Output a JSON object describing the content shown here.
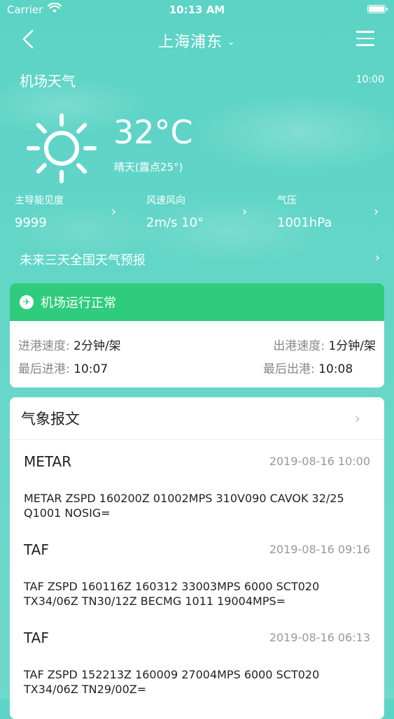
{
  "status_bar": {
    "carrier": "Carrier",
    "time": "10:13 AM"
  },
  "nav": {
    "title": "上海浦东",
    "title_chevron": "⌄"
  },
  "weather": {
    "section_title": "机场天气",
    "update_time": "10:00",
    "temperature": "32°C",
    "condition": "晴天(露点25°)",
    "metrics": [
      {
        "label": "主导能见度",
        "value": "9999"
      },
      {
        "label": "风速风向",
        "value": "2m/s 10°"
      },
      {
        "label": "气压",
        "value": "1001hPa"
      }
    ],
    "forecast_link": "未来三天全国天气预报"
  },
  "operations": {
    "status": "机场运行正常",
    "arrival_speed_label": "进港速度:",
    "arrival_speed_value": "2分钟/架",
    "departure_speed_label": "出港速度:",
    "departure_speed_value": "1分钟/架",
    "last_arrival_label": "最后进港:",
    "last_arrival_value": "10:07",
    "last_departure_label": "最后出港:",
    "last_departure_value": "10:08"
  },
  "reports": {
    "title": "气象报文",
    "items": [
      {
        "type": "METAR",
        "date": "2019-08-16 10:00",
        "text": "METAR ZSPD 160200Z 01002MPS 310V090 CAVOK 32/25 Q1001 NOSIG="
      },
      {
        "type": "TAF",
        "date": "2019-08-16 09:16",
        "text": "TAF ZSPD 160116Z 160312 33003MPS 6000 SCT020 TX34/06Z TN30/12Z BECMG  1011 19004MPS="
      },
      {
        "type": "TAF",
        "date": "2019-08-16 06:13",
        "text": "TAF ZSPD 152213Z 160009 27004MPS 6000 SCT020 TX34/06Z TN29/00Z="
      }
    ]
  },
  "colors": {
    "accent_teal": "#5dd4c6",
    "status_green": "#2fcc7e"
  },
  "icons": {
    "back": "back-chevron-icon",
    "menu": "hamburger-menu-icon",
    "sun": "sun-icon",
    "plane": "airplane-icon",
    "chevron": "chevron-right-icon"
  }
}
